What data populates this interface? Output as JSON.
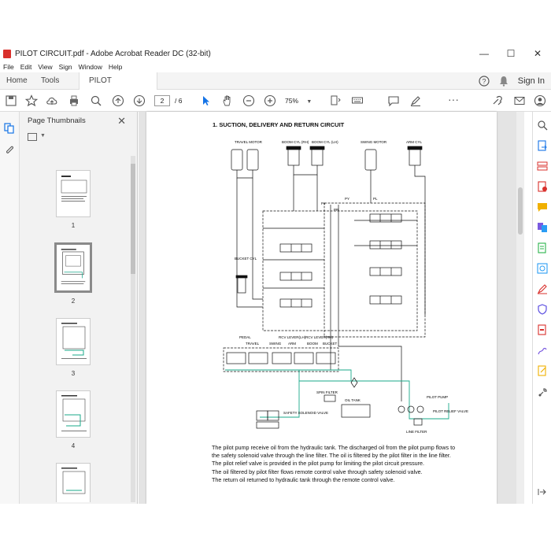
{
  "window": {
    "title": "PILOT CIRCUIT.pdf - Adobe Acrobat Reader DC (32-bit)",
    "controls": {
      "minimize": "—",
      "maximize": "☐",
      "close": "✕"
    }
  },
  "menu": [
    "File",
    "Edit",
    "View",
    "Sign",
    "Window",
    "Help"
  ],
  "tabs": {
    "home": "Home",
    "tools": "Tools",
    "document": "PILOT CIRCUIT.pdf",
    "document_close": "×",
    "sign_in": "Sign In"
  },
  "toolbar": {
    "current_page": "2",
    "total_pages": "/ 6",
    "zoom": "75%"
  },
  "thumbnail_panel": {
    "title": "Page Thumbnails",
    "close": "✕",
    "pages": [
      {
        "label": "1"
      },
      {
        "label": "2",
        "selected": true
      },
      {
        "label": "3"
      },
      {
        "label": "4"
      },
      {
        "label": ""
      }
    ]
  },
  "document": {
    "heading": "1. SUCTION, DELIVERY AND RETURN CIRCUIT",
    "labels": {
      "travel_motor": "TRAVEL MOTOR",
      "boom_cyl_rh": "BOOM CYL (RH)",
      "boom_cyl_lh": "BOOM CYL (LH)",
      "swing_motor": "SWING MOTOR",
      "arm_cyl": "ARM CYL",
      "bucket_cyl": "BUCKET CYL",
      "py": "PY",
      "pl": "PL",
      "ps": "Ps",
      "pr": "PR",
      "pedal": "PEDAL",
      "rcv_lever_lh": "RCV LEVER(LH)",
      "rcv_lever_rh": "RCV LEVER(RH)",
      "travel": "TRAVEL",
      "swing": "SWING",
      "arm": "ARM",
      "boom": "BOOM",
      "bucket": "BUCKET",
      "spin_filter": "SPIN FILTER",
      "oil_tank": "OIL TANK",
      "pilot_pump": "PILOT PUMP",
      "pilot_relief_valve": "PILOT RELIEF VALVE",
      "line_filter": "LINE FILTER",
      "safety_solenoid_valve": "SAFETY SOLENOID VALVE"
    },
    "paragraph": [
      "The pilot pump receive oil from the hydraulic tank.   The discharged oil from the pilot pump flows to",
      "the safety solenoid valve through the line filter.   The oil is filtered by the pilot filter in the line filter.",
      "The pilot relief valve is provided in the pilot pump for limiting the pilot circuit pressure.",
      "The oil filtered by pilot filter flows remote control valve through safety solenoid valve.",
      "The return oil returned to hydraulic tank through the remote control valve."
    ]
  },
  "colors": {
    "pilot_line": "#1aa88a",
    "acrobat_red": "#d9302c",
    "select_blue": "#1473e6"
  }
}
